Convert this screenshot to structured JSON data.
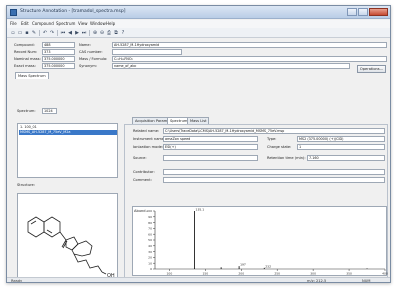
{
  "window": {
    "title": "Structure Annotation - [tramadol_spectra.msp]"
  },
  "menu": {
    "items": [
      "File",
      "Edit",
      "Compound",
      "Spectrum",
      "View",
      "Window",
      "Help"
    ]
  },
  "compound_fields": {
    "compound_label": "Compound:",
    "compound_value": "488",
    "record_no_label": "Record Num:",
    "record_no_value": "373",
    "nominal_mass_label": "Nominal mass:",
    "nominal_mass_value": "375.000000",
    "exact_mass_label": "Exact mass:",
    "exact_mass_value": "375.000000",
    "name_label": "Name:",
    "name_value": "AH-5287_M-1Hydroxyamid",
    "cas_label": "CAS number:",
    "cas_value": "",
    "formula_label": "Mass / Formula:",
    "formula_value": "C₂₁H₂₅FNO₂",
    "synonym_label": "Synonym:",
    "synonym_value": "name_of_abc",
    "operations_label": "Operations..."
  },
  "tabs": {
    "main": "Mass Spectrum",
    "acquisition": "Acquisition Parameters",
    "spectrum_info": "Spectrum Info",
    "mass_list": "Mass List"
  },
  "spectrum_list": {
    "label": "Spectrum:",
    "count_value": "1024",
    "items": [
      "1. 100_01",
      "MSMS_AH-5287_M_75eV_M2a"
    ]
  },
  "structure": {
    "label": "Structure:",
    "substituent": "OH"
  },
  "spectrum_info": {
    "file_label": "Related name:",
    "file_value": "C:\\Users\\TraceData\\LCMS\\AH-5287_M-1Hydroxyamid_MSMS_75eV.msp",
    "instrument_label": "Instrument name:",
    "instrument_value": "amaZon speed",
    "type_label": "Type:",
    "type_value": "MS2 (375.00000) (+)(CID)",
    "ionization_label": "Ionization mode:",
    "ionization_value": "ESI(+)",
    "charge_label": "Charge state:",
    "charge_value": "1",
    "source_label": "Source:",
    "source_value": "",
    "retention_label": "Retention time (min):",
    "retention_value": "7.160",
    "contributor_label": "Contributor:",
    "contributor_value": "",
    "comment_label": "Comment:",
    "comment_value": ""
  },
  "chart_data": {
    "type": "bar",
    "x": [
      135,
      172,
      197,
      232,
      375
    ],
    "values": [
      100,
      3,
      5,
      2,
      1
    ],
    "labels": [
      "135.1",
      "",
      "197",
      "232",
      ""
    ],
    "xlim": [
      80,
      400
    ],
    "ylim": [
      0,
      100
    ],
    "xlabel": "",
    "ylabel": "Abund.",
    "yticks": [
      0,
      10,
      20,
      30,
      40,
      50,
      60,
      70,
      80,
      90,
      100
    ],
    "xticks": [
      100,
      150,
      200,
      250,
      300,
      350,
      400
    ],
    "grid": false
  },
  "status": {
    "left": "Ready",
    "middle": "m/z: 212.5",
    "right": "NUM"
  },
  "colors": {
    "title_bar": "#c2d3ea",
    "selection": "#3a78c8",
    "spectrum_line": "#000000"
  }
}
